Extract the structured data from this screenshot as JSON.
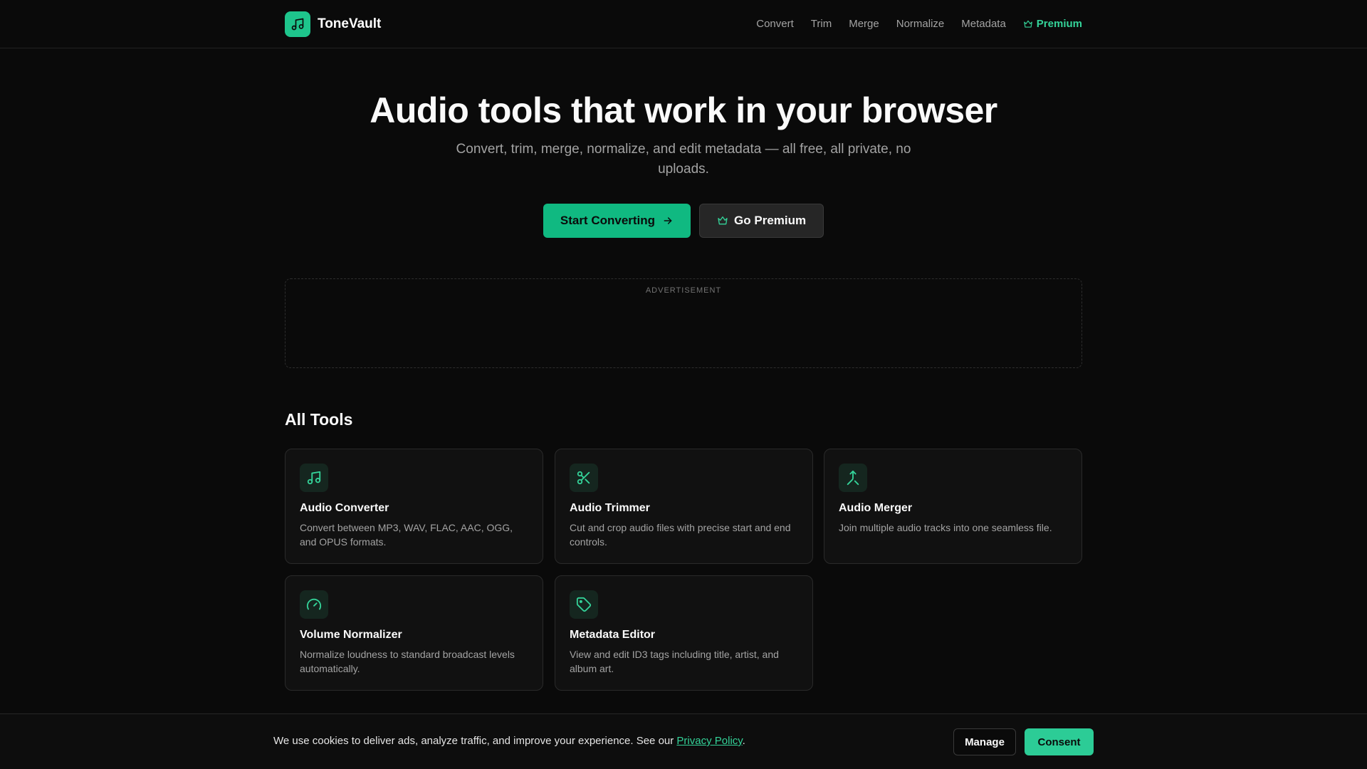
{
  "brand": {
    "name": "ToneVault",
    "logo_icon": "music-note-icon",
    "accent_color": "#10b981"
  },
  "nav": {
    "items": [
      "Convert",
      "Trim",
      "Merge",
      "Normalize",
      "Metadata"
    ],
    "premium_label": "Premium",
    "premium_icon": "crown-icon"
  },
  "hero": {
    "title": "Audio tools that work in your browser",
    "subtitle": "Convert, trim, merge, normalize, and edit metadata — all free, all private, no uploads.",
    "primary_cta": "Start Converting",
    "secondary_cta": "Go Premium"
  },
  "ad": {
    "label": "ADVERTISEMENT"
  },
  "tools": {
    "heading": "All Tools",
    "items": [
      {
        "title": "Audio Converter",
        "desc": "Convert between MP3, WAV, FLAC, AAC, OGG, and OPUS formats.",
        "icon": "music-note-icon"
      },
      {
        "title": "Audio Trimmer",
        "desc": "Cut and crop audio files with precise start and end controls.",
        "icon": "scissors-icon"
      },
      {
        "title": "Audio Merger",
        "desc": "Join multiple audio tracks into one seamless file.",
        "icon": "merge-icon"
      },
      {
        "title": "Volume Normalizer",
        "desc": "Normalize loudness to standard broadcast levels automatically.",
        "icon": "gauge-icon"
      },
      {
        "title": "Metadata Editor",
        "desc": "View and edit ID3 tags including title, artist, and album art.",
        "icon": "tag-icon"
      }
    ]
  },
  "cookie": {
    "text_before": "We use cookies to deliver ads, analyze traffic, and improve your experience. See our ",
    "link": "Privacy Policy",
    "text_after": ".",
    "manage_label": "Manage",
    "consent_label": "Consent"
  }
}
